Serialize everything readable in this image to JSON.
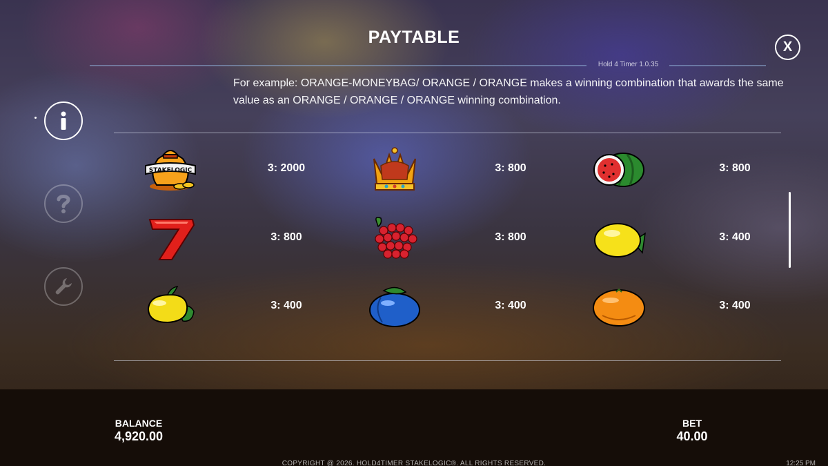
{
  "header": {
    "title": "PAYTABLE",
    "version": "Hold 4 Timer 1.0.35",
    "close_label": "X"
  },
  "side_nav": {
    "items": [
      {
        "icon": "info-icon",
        "state": "active"
      },
      {
        "icon": "question-icon",
        "state": "inactive"
      },
      {
        "icon": "wrench-icon",
        "state": "inactive"
      }
    ]
  },
  "content": {
    "example_text": "For example: ORANGE-MONEYBAG/ ORANGE / ORANGE makes a winning combination that awards the same value as an ORANGE / ORANGE / ORANGE winning combination."
  },
  "paytable": [
    {
      "symbol": "moneybag-icon",
      "brand": "STAKELOGIC",
      "value": "3: 2000"
    },
    {
      "symbol": "crown-icon",
      "value": "3: 800"
    },
    {
      "symbol": "watermelon-icon",
      "value": "3: 800"
    },
    {
      "symbol": "seven-icon",
      "value": "3: 800"
    },
    {
      "symbol": "raspberry-icon",
      "value": "3: 800"
    },
    {
      "symbol": "lemon-icon",
      "value": "3: 400"
    },
    {
      "symbol": "pear-icon",
      "value": "3: 400"
    },
    {
      "symbol": "plum-icon",
      "value": "3: 400"
    },
    {
      "symbol": "orange-icon",
      "value": "3: 400"
    }
  ],
  "footer": {
    "balance_label": "BALANCE",
    "balance_value": "4,920.00",
    "bet_label": "BET",
    "bet_value": "40.00",
    "copyright": "COPYRIGHT @ 2026. HOLD4TIMER STAKELOGIC®. ALL RIGHTS RESERVED.",
    "clock": "12:25 PM"
  },
  "colors": {
    "bottom_bar": "#150d08",
    "text": "#ffffff"
  }
}
